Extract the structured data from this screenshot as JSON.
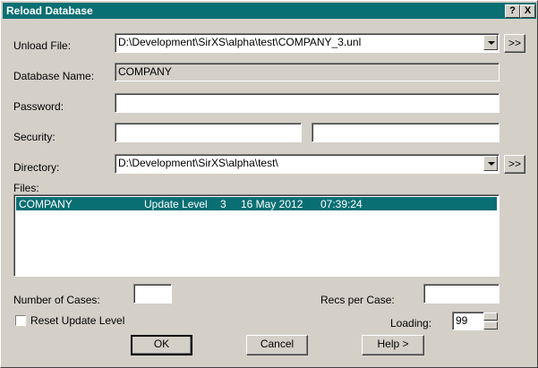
{
  "window": {
    "title": "Reload Database",
    "help_button": "?",
    "close_button": "X"
  },
  "fields": {
    "unload_file": {
      "label": "Unload File:",
      "value": "D:\\Development\\SirXS\\alpha\\test\\COMPANY_3.unl",
      "browse": ">>"
    },
    "database_name": {
      "label": "Database Name:",
      "value": "COMPANY"
    },
    "password": {
      "label": "Password:",
      "value": ""
    },
    "security": {
      "label": "Security:",
      "value1": "",
      "value2": ""
    },
    "directory": {
      "label": "Directory:",
      "value": "D:\\Development\\SirXS\\alpha\\test\\",
      "browse": ">>"
    },
    "files": {
      "label": "Files:",
      "rows": [
        {
          "name": "COMPANY",
          "desc": "Update Level",
          "level": "3",
          "date": "16 May 2012",
          "time": "07:39:24"
        }
      ]
    },
    "number_of_cases": {
      "label": "Number of Cases:",
      "value": ""
    },
    "recs_per_case": {
      "label": "Recs per Case:",
      "value": ""
    },
    "reset_update_level": {
      "label": "Reset Update Level",
      "checked": false
    },
    "loading": {
      "label": "Loading:",
      "value": "99"
    }
  },
  "buttons": {
    "ok": "OK",
    "cancel": "Cancel",
    "help": "Help >"
  },
  "colors": {
    "titlebar": "#0a6f73",
    "selection": "#0a6f73",
    "face": "#d4d0c8"
  }
}
